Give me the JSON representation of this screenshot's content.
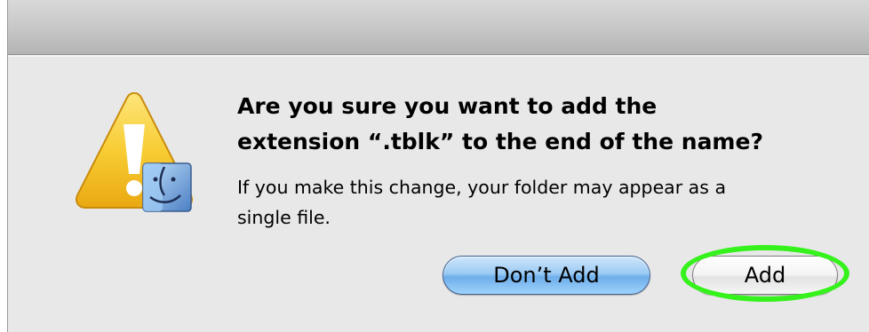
{
  "dialog": {
    "headline_line1": "Are you sure you want to add the",
    "headline_line2": "extension “.tblk” to the end of the name?",
    "informative_line1": "If you make this change, your folder may appear as a",
    "informative_line2": "single file.",
    "icon": "caution-finder-icon"
  },
  "buttons": {
    "dont_add_label": "Don’t Add",
    "add_label": "Add"
  },
  "colors": {
    "highlight_ring": "#35f21c",
    "default_button": "#7eb8ef",
    "caution_yellow": "#f6c42a"
  }
}
